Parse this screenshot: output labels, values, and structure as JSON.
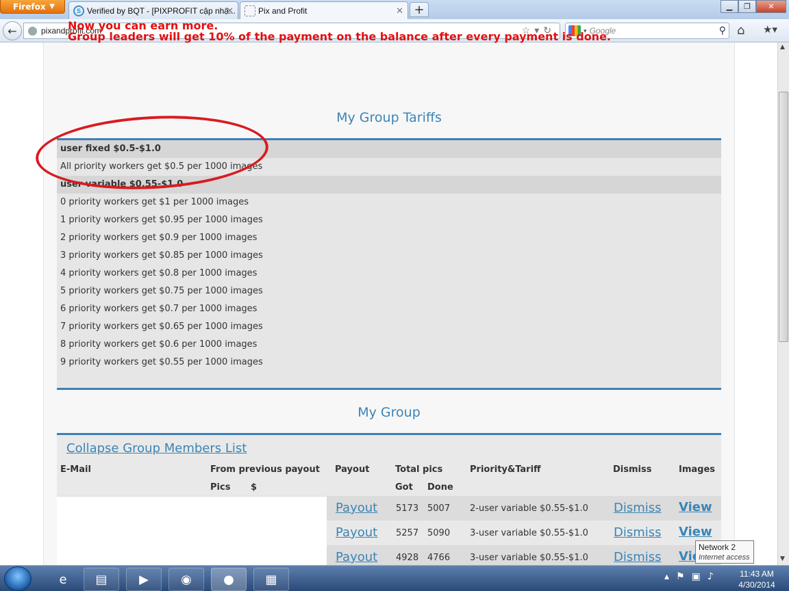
{
  "browser": {
    "menu_button": "Firefox",
    "tabs": [
      {
        "title": "Verified by BQT - [PIXPROFIT cập nhậ..."
      },
      {
        "title": "Pix and Profit"
      }
    ],
    "new_tab": "+",
    "url": "pixandprofit.com",
    "search_placeholder": "Google"
  },
  "page": {
    "notice_line1": "Now you can earn more.",
    "notice_line2": "Group leaders will get 10% of the payment on the balance after every payment is done.",
    "tariffs_title": "My Group Tariffs",
    "tariff_rows": [
      {
        "text": "user fixed $0.5-$1.0",
        "head": true
      },
      {
        "text": "All priority workers get $0.5 per 1000 images",
        "head": false
      },
      {
        "text": "user variable $0.55-$1.0",
        "head": true
      },
      {
        "text": "0 priority workers get $1 per 1000 images",
        "head": false
      },
      {
        "text": "1 priority workers get $0.95 per 1000 images",
        "head": false
      },
      {
        "text": "2 priority workers get $0.9 per 1000 images",
        "head": false
      },
      {
        "text": "3 priority workers get $0.85 per 1000 images",
        "head": false
      },
      {
        "text": "4 priority workers get $0.8 per 1000 images",
        "head": false
      },
      {
        "text": "5 priority workers get $0.75 per 1000 images",
        "head": false
      },
      {
        "text": "6 priority workers get $0.7 per 1000 images",
        "head": false
      },
      {
        "text": "7 priority workers get $0.65 per 1000 images",
        "head": false
      },
      {
        "text": "8 priority workers get $0.6 per 1000 images",
        "head": false
      },
      {
        "text": "9 priority workers get $0.55 per 1000 images",
        "head": false
      }
    ],
    "group_title": "My Group",
    "collapse_link": "Collapse Group Members List",
    "headers": {
      "email": "E-Mail",
      "from_prev": "From previous payout",
      "pics": "Pics",
      "dollar": "$",
      "payout": "Payout",
      "total_pics": "Total pics",
      "got": "Got",
      "done": "Done",
      "priority": "Priority&Tariff",
      "dismiss": "Dismiss",
      "images": "Images"
    },
    "members": [
      {
        "payout": "Payout",
        "got": "5173",
        "done": "5007",
        "tariff": "2-user variable $0.55-$1.0",
        "dismiss": "Dismiss",
        "view": "View"
      },
      {
        "payout": "Payout",
        "got": "5257",
        "done": "5090",
        "tariff": "3-user variable $0.55-$1.0",
        "dismiss": "Dismiss",
        "view": "View"
      },
      {
        "payout": "Payout",
        "got": "4928",
        "done": "4766",
        "tariff": "3-user variable $0.55-$1.0",
        "dismiss": "Dismiss",
        "view": "Vie"
      }
    ]
  },
  "taskbar": {
    "tooltip_title": "Network  2",
    "tooltip_sub": "Internet access",
    "time": "11:43 AM",
    "date": "4/30/2014"
  }
}
